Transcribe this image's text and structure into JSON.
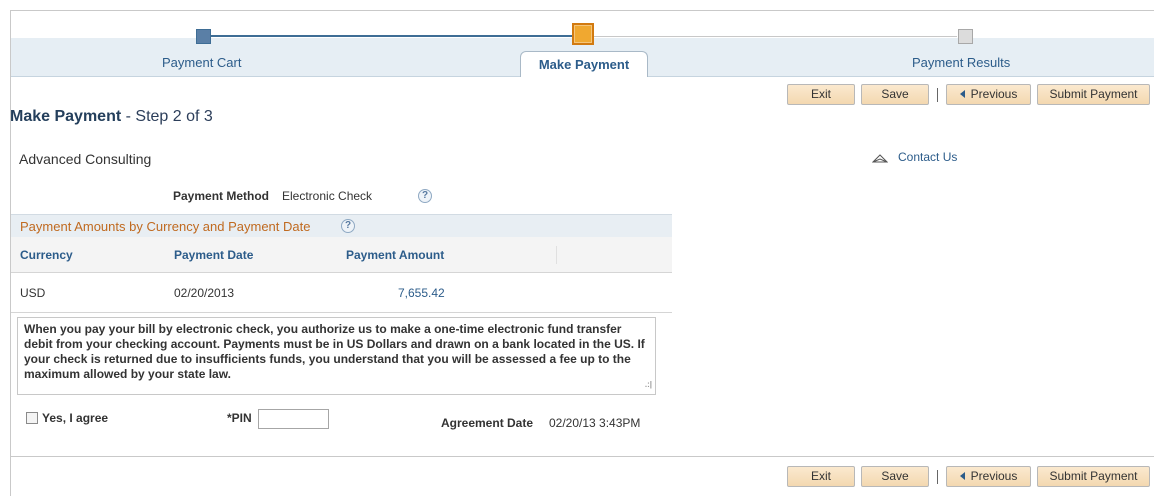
{
  "train": {
    "steps": [
      {
        "label": "Payment Cart"
      },
      {
        "label": "Make Payment"
      },
      {
        "label": "Payment Results"
      }
    ]
  },
  "toolbar": {
    "exit": "Exit",
    "save": "Save",
    "separator": "|",
    "previous": "Previous",
    "submit": "Submit Payment"
  },
  "page": {
    "title_bold": "Make Payment",
    "title_rest": " - Step 2 of 3",
    "company": "Advanced Consulting",
    "contact": "Contact Us"
  },
  "payment_method": {
    "label": "Payment Method",
    "value": "Electronic Check",
    "help": "?"
  },
  "grid": {
    "title": "Payment Amounts by Currency and Payment Date",
    "help": "?",
    "columns": [
      "Currency",
      "Payment Date",
      "Payment Amount"
    ],
    "rows": [
      {
        "currency": "USD",
        "date": "02/20/2013",
        "amount": "7,655.42"
      }
    ]
  },
  "agreement": {
    "text": "When you pay your bill by electronic check, you authorize us to make a one-time electronic fund transfer debit from your checking account. Payments must be in US Dollars and drawn on a bank located in the US. If your check is returned due to insufficients funds, you understand that you will be assessed a fee up to the maximum allowed by your state law.",
    "agree_label": "Yes, I agree",
    "pin_label": "*PIN",
    "date_label": "Agreement Date",
    "date_value": "02/20/13  3:43PM"
  },
  "colors": {
    "accent": "#2c5c8a",
    "active_step": "#f0a830",
    "button": "#f3d8b0"
  }
}
